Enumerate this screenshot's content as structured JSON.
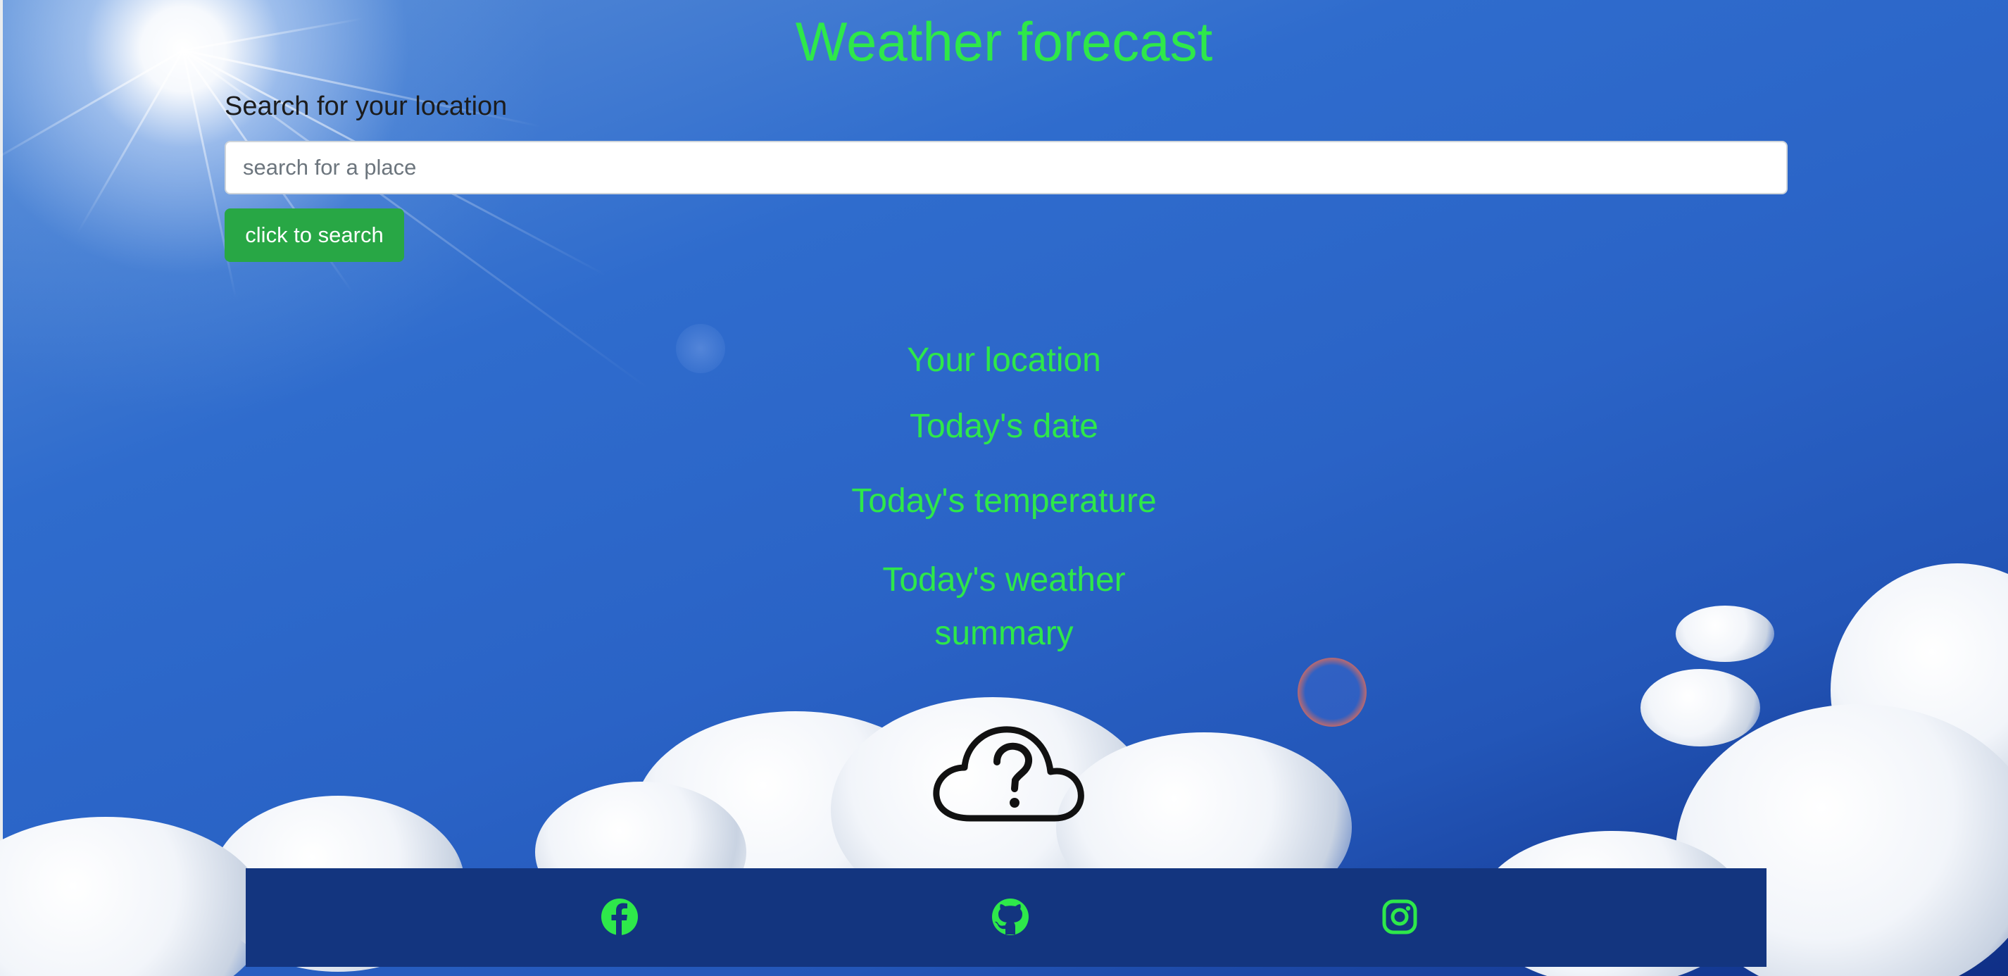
{
  "page": {
    "title": "Weather forecast"
  },
  "search": {
    "label": "Search for your location",
    "placeholder": "search for a place",
    "value": "",
    "button_label": "click to search"
  },
  "forecast": {
    "location": "Your location",
    "date": "Today's date",
    "temperature": "Today's temperature",
    "summary": "Today's weather summary",
    "icon": "cloud-question-icon"
  },
  "footer": {
    "links": [
      {
        "icon": "facebook-icon"
      },
      {
        "icon": "github-icon"
      },
      {
        "icon": "instagram-icon"
      }
    ]
  },
  "colors": {
    "accent_text": "#2ee84a",
    "button": "#28a745",
    "footer_bg": "#13357f",
    "social_icon": "#2ee84a"
  }
}
